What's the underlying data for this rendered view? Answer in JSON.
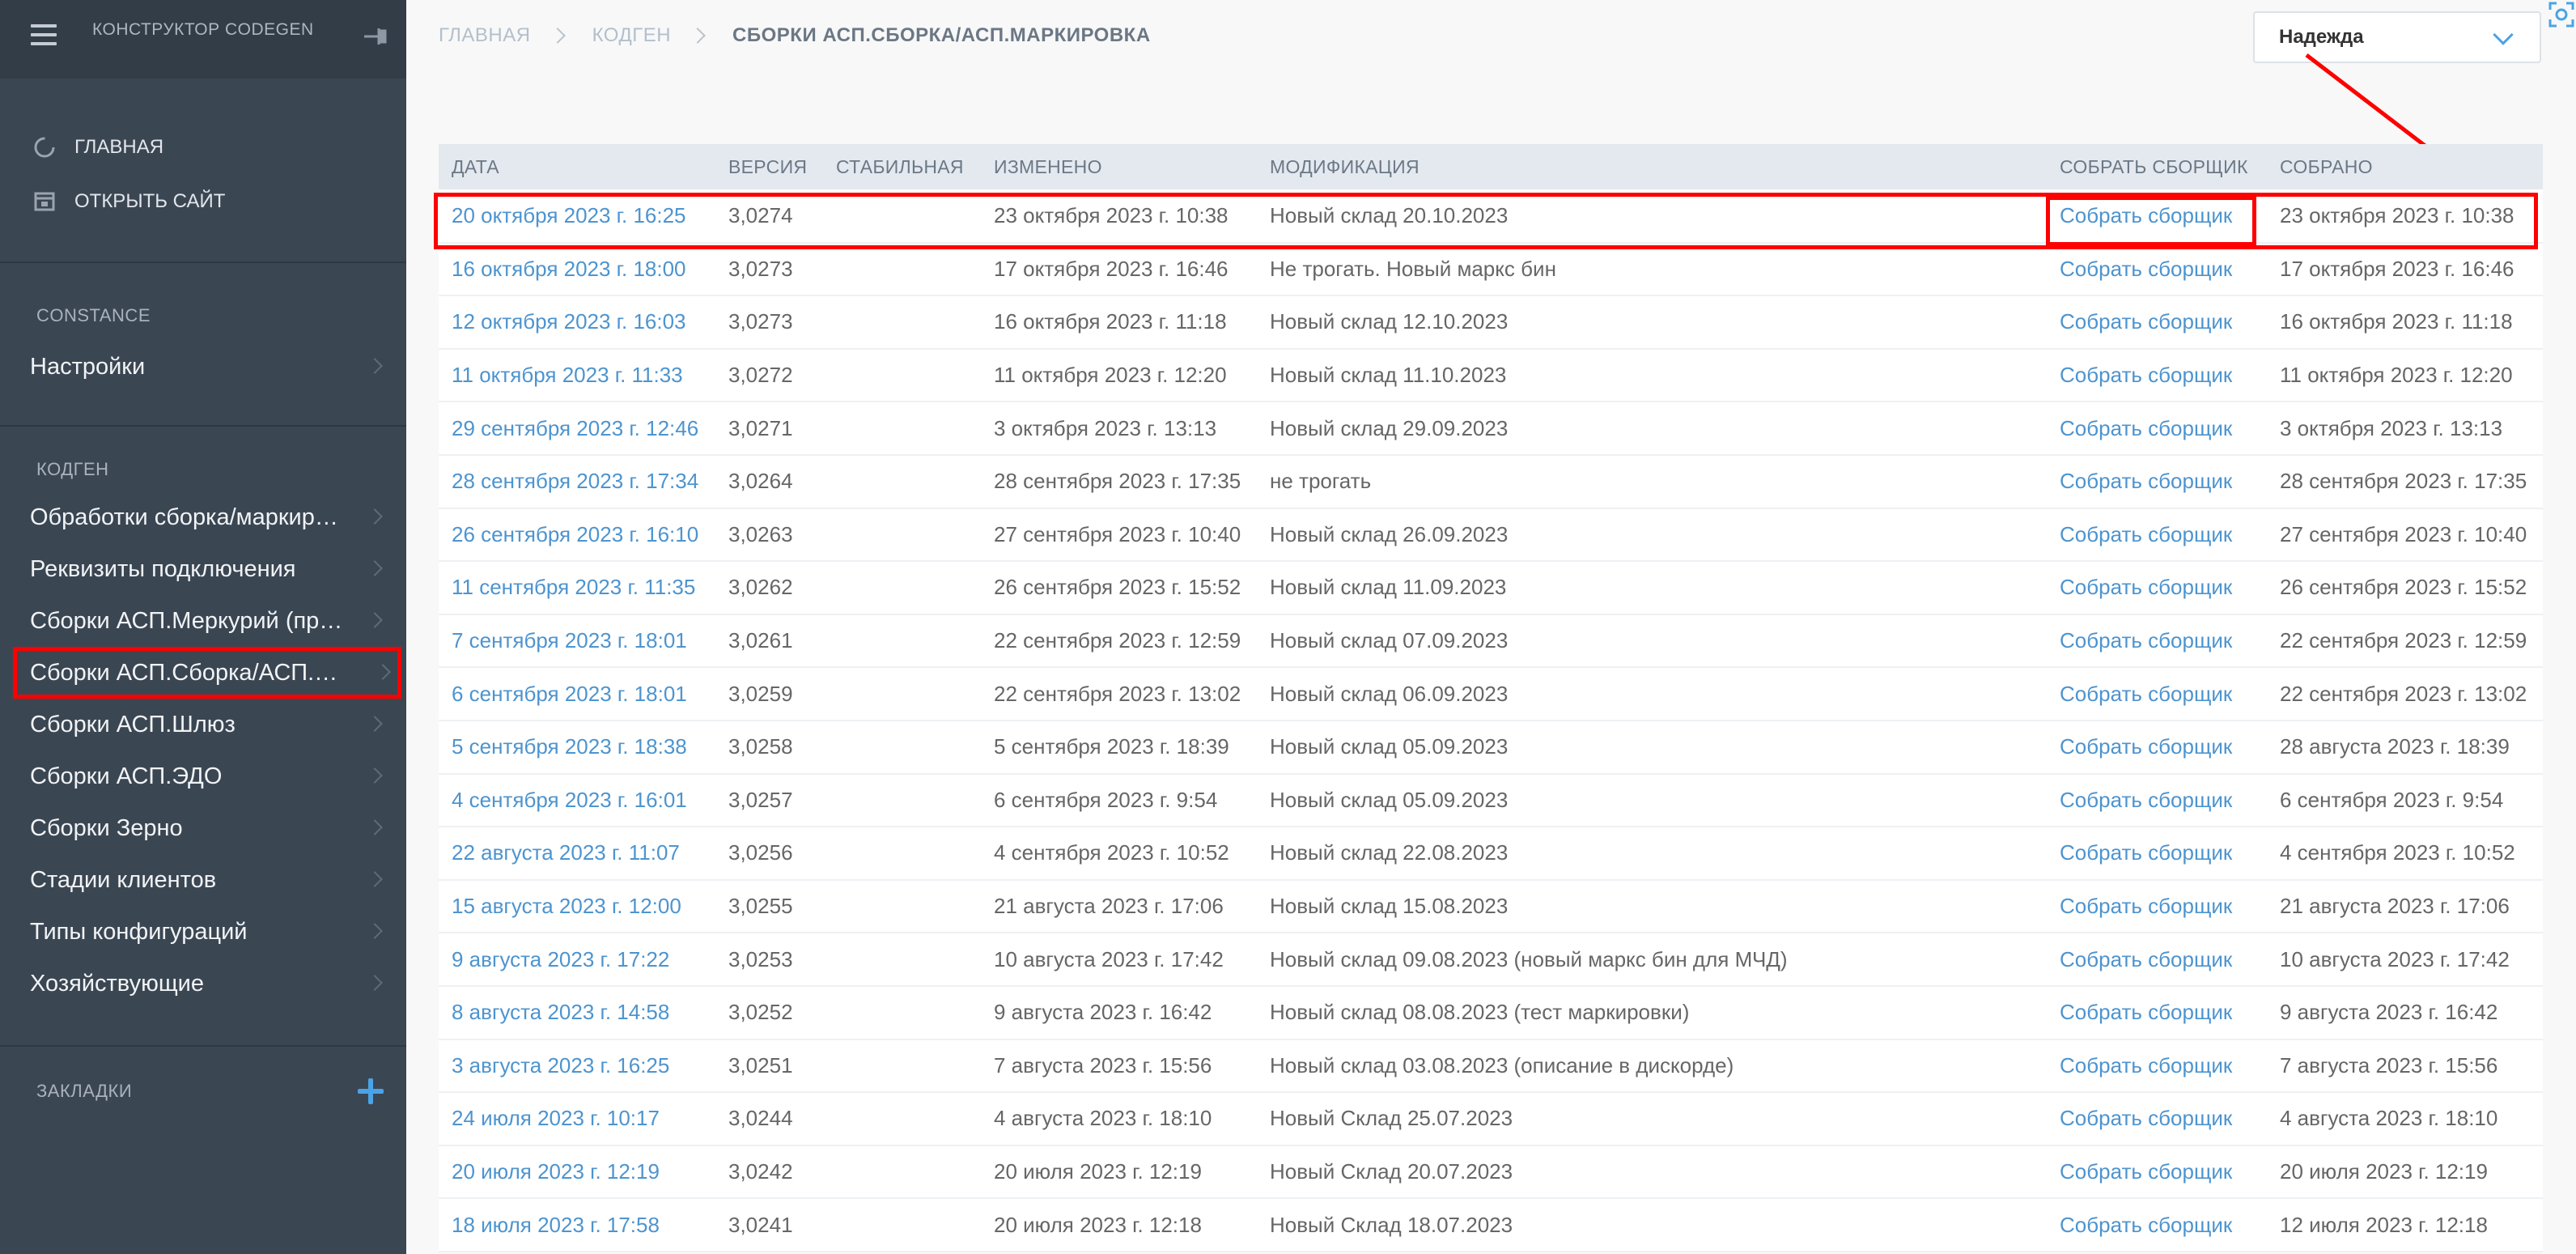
{
  "sidebar": {
    "title": "КОНСТРУКТОР CODEGEN",
    "links": [
      {
        "label": "ГЛАВНАЯ"
      },
      {
        "label": "ОТКРЫТЬ САЙТ"
      }
    ],
    "sections": [
      {
        "title": "CONSTANCE",
        "items": [
          {
            "label": "Настройки"
          }
        ]
      },
      {
        "title": "КОДГЕН",
        "items": [
          {
            "label": "Обработки сборка/маркиро…"
          },
          {
            "label": "Реквизиты подключения"
          },
          {
            "label": "Сборки АСП.Меркурий (пр…"
          },
          {
            "label": "Сборки АСП.Сборка/АСП.…"
          },
          {
            "label": "Сборки АСП.Шлюз"
          },
          {
            "label": "Сборки АСП.ЭДО"
          },
          {
            "label": "Сборки Зерно"
          },
          {
            "label": "Стадии клиентов"
          },
          {
            "label": "Типы конфигураций"
          },
          {
            "label": "Хозяйствующие"
          }
        ]
      }
    ],
    "bookmarks_title": "ЗАКЛАДКИ"
  },
  "breadcrumbs": {
    "home": "ГЛАВНАЯ",
    "section": "КОДГЕН",
    "current": "СБОРКИ АСП.СБОРКА/АСП.МАРКИРОВКА"
  },
  "user": {
    "name": "Надежда"
  },
  "table": {
    "headers": [
      "ДАТА",
      "ВЕРСИЯ",
      "СТАБИЛЬНАЯ",
      "ИЗМЕНЕНО",
      "МОДИФИКАЦИЯ",
      "СОБРАТЬ СБОРЩИК",
      "СОБРАНО"
    ],
    "rows": [
      [
        "20 октября 2023 г. 16:25",
        "3,0274",
        "",
        "23 октября 2023 г. 10:38",
        "Новый склад 20.10.2023",
        "Собрать сборщик",
        "23 октября 2023 г. 10:38"
      ],
      [
        "16 октября 2023 г. 18:00",
        "3,0273",
        "",
        "17 октября 2023 г. 16:46",
        "Не трогать. Новый маркс бин",
        "Собрать сборщик",
        "17 октября 2023 г. 16:46"
      ],
      [
        "12 октября 2023 г. 16:03",
        "3,0273",
        "",
        "16 октября 2023 г. 11:18",
        "Новый склад 12.10.2023",
        "Собрать сборщик",
        "16 октября 2023 г. 11:18"
      ],
      [
        "11 октября 2023 г. 11:33",
        "3,0272",
        "",
        "11 октября 2023 г. 12:20",
        "Новый склад 11.10.2023",
        "Собрать сборщик",
        "11 октября 2023 г. 12:20"
      ],
      [
        "29 сентября 2023 г. 12:46",
        "3,0271",
        "",
        "3 октября 2023 г. 13:13",
        "Новый склад 29.09.2023",
        "Собрать сборщик",
        "3 октября 2023 г. 13:13"
      ],
      [
        "28 сентября 2023 г. 17:34",
        "3,0264",
        "",
        "28 сентября 2023 г. 17:35",
        "не трогать",
        "Собрать сборщик",
        "28 сентября 2023 г. 17:35"
      ],
      [
        "26 сентября 2023 г. 16:10",
        "3,0263",
        "",
        "27 сентября 2023 г. 10:40",
        "Новый склад 26.09.2023",
        "Собрать сборщик",
        "27 сентября 2023 г. 10:40"
      ],
      [
        "11 сентября 2023 г. 11:35",
        "3,0262",
        "",
        "26 сентября 2023 г. 15:52",
        "Новый склад 11.09.2023",
        "Собрать сборщик",
        "26 сентября 2023 г. 15:52"
      ],
      [
        "7 сентября 2023 г. 18:01",
        "3,0261",
        "",
        "22 сентября 2023 г. 12:59",
        "Новый склад 07.09.2023",
        "Собрать сборщик",
        "22 сентября 2023 г. 12:59"
      ],
      [
        "6 сентября 2023 г. 18:01",
        "3,0259",
        "",
        "22 сентября 2023 г. 13:02",
        "Новый склад 06.09.2023",
        "Собрать сборщик",
        "22 сентября 2023 г. 13:02"
      ],
      [
        "5 сентября 2023 г. 18:38",
        "3,0258",
        "",
        "5 сентября 2023 г. 18:39",
        "Новый склад 05.09.2023",
        "Собрать сборщик",
        "28 августа 2023 г. 18:39"
      ],
      [
        "4 сентября 2023 г. 16:01",
        "3,0257",
        "",
        "6 сентября 2023 г. 9:54",
        "Новый склад 05.09.2023",
        "Собрать сборщик",
        "6 сентября 2023 г. 9:54"
      ],
      [
        "22 августа 2023 г. 11:07",
        "3,0256",
        "",
        "4 сентября 2023 г. 10:52",
        "Новый склад 22.08.2023",
        "Собрать сборщик",
        "4 сентября 2023 г. 10:52"
      ],
      [
        "15 августа 2023 г. 12:00",
        "3,0255",
        "",
        "21 августа 2023 г. 17:06",
        "Новый склад 15.08.2023",
        "Собрать сборщик",
        "21 августа 2023 г. 17:06"
      ],
      [
        "9 августа 2023 г. 17:22",
        "3,0253",
        "",
        "10 августа 2023 г. 17:42",
        "Новый склад 09.08.2023 (новый маркс бин для МЧД)",
        "Собрать сборщик",
        "10 августа 2023 г. 17:42"
      ],
      [
        "8 августа 2023 г. 14:58",
        "3,0252",
        "",
        "9 августа 2023 г. 16:42",
        "Новый склад 08.08.2023 (тест маркировки)",
        "Собрать сборщик",
        "9 августа 2023 г. 16:42"
      ],
      [
        "3 августа 2023 г. 16:25",
        "3,0251",
        "",
        "7 августа 2023 г. 15:56",
        "Новый склад 03.08.2023 (описание в дискорде)",
        "Собрать сборщик",
        "7 августа 2023 г. 15:56"
      ],
      [
        "24 июля 2023 г. 10:17",
        "3,0244",
        "",
        "4 августа 2023 г. 18:10",
        "Новый Склад 25.07.2023",
        "Собрать сборщик",
        "4 августа 2023 г. 18:10"
      ],
      [
        "20 июля 2023 г. 12:19",
        "3,0242",
        "",
        "20 июля 2023 г. 12:19",
        "Новый Склад 20.07.2023",
        "Собрать сборщик",
        "20 июля 2023 г. 12:19"
      ],
      [
        "18 июля 2023 г. 17:58",
        "3,0241",
        "",
        "20 июля 2023 г. 12:18",
        "Новый Склад 18.07.2023",
        "Собрать сборщик",
        "12 июля 2023 г. 12:18"
      ]
    ]
  },
  "colors": {
    "sidebar_bg": "#3b4653",
    "link": "#4d94cf",
    "highlight": "#ff0000",
    "header_bg": "#e3e9ef"
  }
}
